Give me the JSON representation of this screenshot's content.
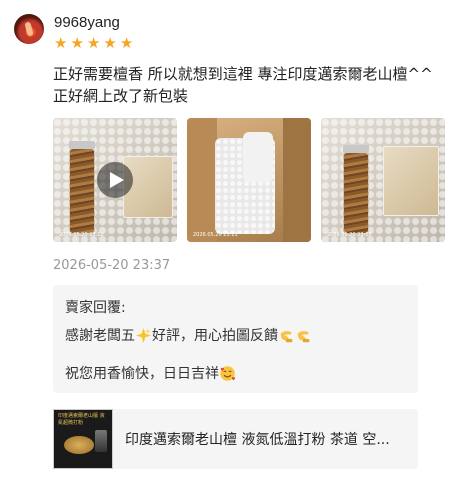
{
  "review": {
    "username": "9968yang",
    "rating": 5,
    "rating_stars": [
      "★",
      "★",
      "★",
      "★",
      "★"
    ],
    "text": "正好需要檀香  所以就想到這裡   專注印度邁索爾老山檀^^    正好網上改了新包裝",
    "photos": [
      {
        "kind": "video",
        "timestamp": "2026.05.20 23:12"
      },
      {
        "kind": "image",
        "timestamp": "2026.05.20 23:11"
      },
      {
        "kind": "image",
        "timestamp": "2026.05.20 23:02"
      }
    ],
    "date": "2026-05-20 23:37"
  },
  "seller_reply": {
    "title": "賣家回覆:",
    "line1": "感謝老闆五",
    "line1_after": "好評，用心拍圖反饋",
    "line2": "祝您用香愉快，日日吉祥"
  },
  "product": {
    "title": "印度邁索爾老山檀 液氮低溫打粉 茶道 空...",
    "thumb_caption": "印度邁索爾老山檀 液氮超微打粉"
  },
  "colors": {
    "star": "#f5a524",
    "date": "#999999",
    "reply_bg": "#f5f5f5"
  },
  "icons": [
    "avatar",
    "star-icon",
    "play-icon",
    "sparkle-emoji",
    "hand-emoji",
    "smiling-face-with-hearts-emoji"
  ]
}
